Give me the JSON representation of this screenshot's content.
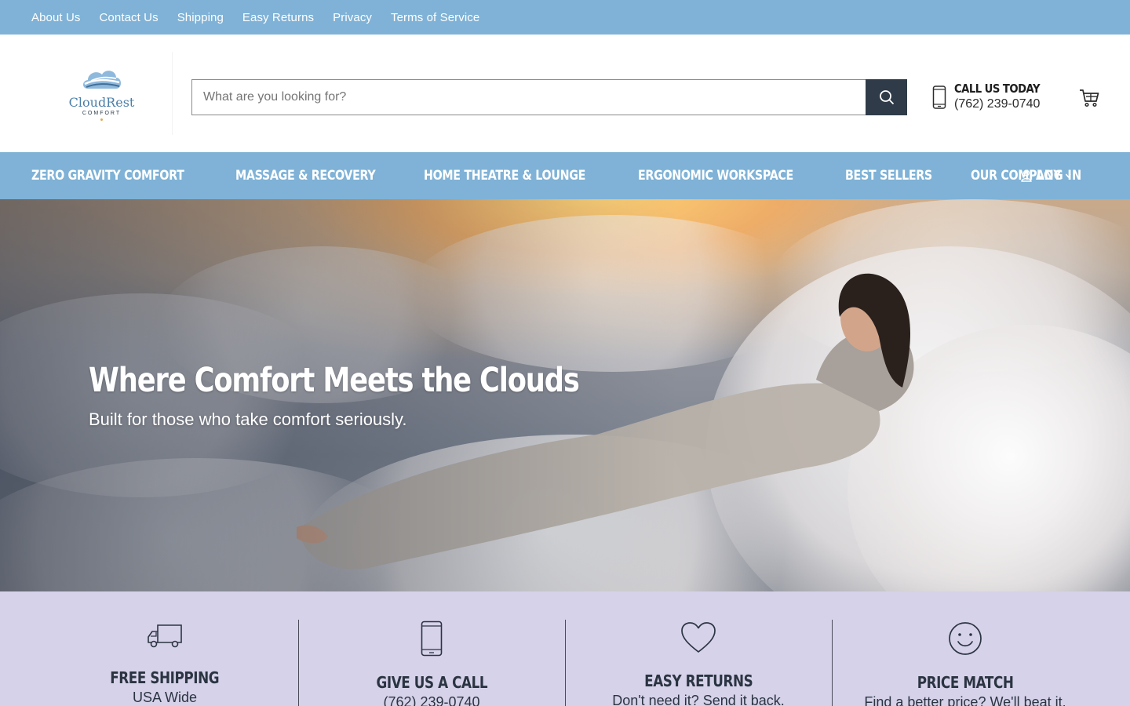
{
  "topbar": {
    "links": [
      "About Us",
      "Contact Us",
      "Shipping",
      "Easy Returns",
      "Privacy",
      "Terms of Service"
    ]
  },
  "logo": {
    "name": "CloudRest",
    "sub": "COMFORT"
  },
  "search": {
    "placeholder": "What are you looking for?",
    "value": ""
  },
  "call": {
    "title": "CALL US TODAY",
    "phone": "(762) 239-0740"
  },
  "nav": {
    "items": [
      "ZERO GRAVITY COMFORT",
      "MASSAGE & RECOVERY",
      "HOME THEATRE & LOUNGE",
      "ERGONOMIC WORKSPACE",
      "BEST SELLERS",
      "OUR COMPANY"
    ],
    "login": "LOG IN"
  },
  "hero": {
    "title": "Where Comfort Meets the Clouds",
    "subtitle": "Built for those who take comfort seriously."
  },
  "features": [
    {
      "icon": "truck-icon",
      "title": "FREE SHIPPING",
      "text": "USA Wide"
    },
    {
      "icon": "phone-icon",
      "title": "GIVE US A CALL",
      "text": "(762) 239-0740"
    },
    {
      "icon": "heart-icon",
      "title": "EASY RETURNS",
      "text": "Don't need it? Send it back."
    },
    {
      "icon": "smiley-icon",
      "title": "PRICE MATCH",
      "text": "Find a better price? We'll beat it."
    }
  ],
  "colors": {
    "bar": "#7fb2d6",
    "features_bg": "#d6d2ea",
    "search_button": "#2f3b48",
    "text_dark": "#2b3441"
  }
}
